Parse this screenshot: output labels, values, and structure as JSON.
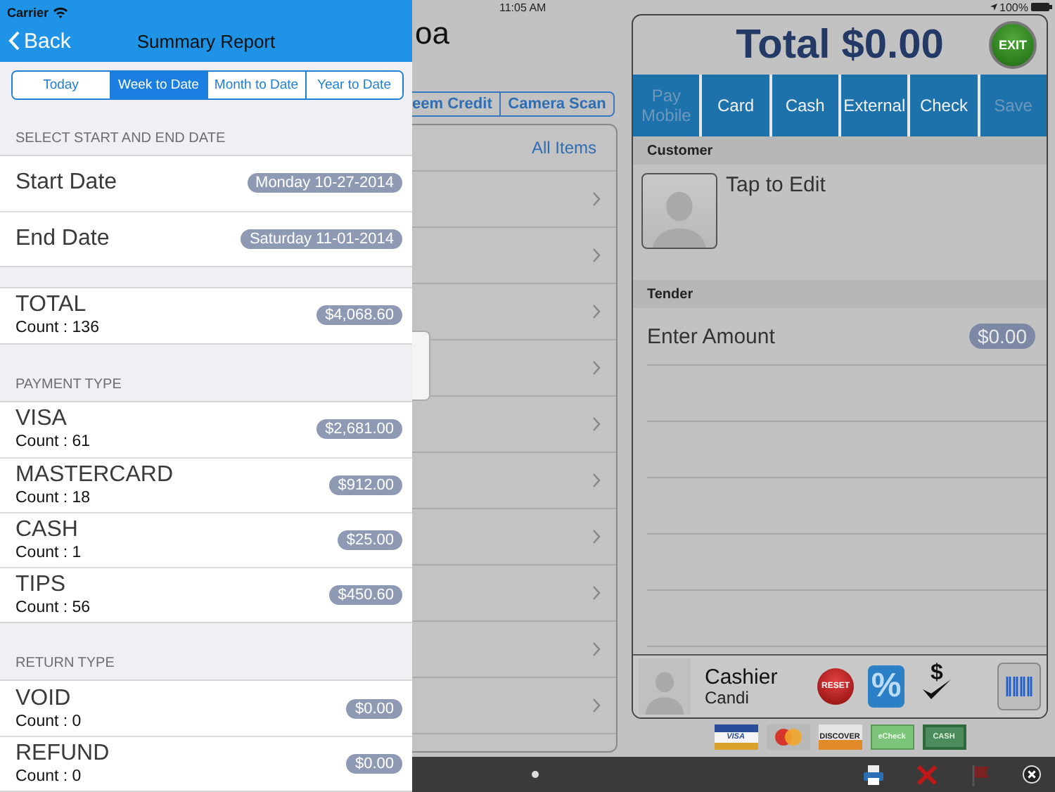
{
  "status_bar": {
    "carrier": "Carrier",
    "time": "11:05 AM",
    "battery": "100%"
  },
  "report": {
    "back": "Back",
    "title": "Summary Report",
    "periods": [
      {
        "label": "Today",
        "selected": false
      },
      {
        "label": "Week to Date",
        "selected": true
      },
      {
        "label": "Month to Date",
        "selected": false
      },
      {
        "label": "Year to Date",
        "selected": false
      }
    ],
    "sections": [
      {
        "header": "SELECT START AND END DATE",
        "rows": [
          {
            "title": "Start Date",
            "value": "Monday 10-27-2014"
          },
          {
            "title": "End Date",
            "value": "Saturday 11-01-2014"
          }
        ]
      },
      {
        "rows": [
          {
            "title": "TOTAL",
            "count": "Count : 136",
            "value": "$4,068.60"
          }
        ]
      },
      {
        "header": "PAYMENT TYPE",
        "rows": [
          {
            "title": "VISA",
            "count": "Count : 61",
            "value": "$2,681.00"
          },
          {
            "title": "MASTERCARD",
            "count": "Count : 18",
            "value": "$912.00"
          },
          {
            "title": "CASH",
            "count": "Count : 1",
            "value": "$25.00"
          },
          {
            "title": "TIPS",
            "count": "Count : 56",
            "value": "$450.60"
          }
        ]
      },
      {
        "header": "RETURN TYPE",
        "rows": [
          {
            "title": "VOID",
            "count": "Count : 0",
            "value": "$0.00"
          },
          {
            "title": "REFUND",
            "count": "Count : 0",
            "value": "$0.00"
          }
        ]
      }
    ]
  },
  "register": {
    "title": "oa",
    "actions": [
      {
        "label": "eem Credit"
      },
      {
        "label": "Camera Scan"
      }
    ],
    "list_header": "All Items"
  },
  "checkout": {
    "total": "Total $0.00",
    "exit": "EXIT",
    "tenders": [
      {
        "label": "Pay Mobile",
        "disabled": true
      },
      {
        "label": "Card",
        "disabled": false
      },
      {
        "label": "Cash",
        "disabled": false
      },
      {
        "label": "External",
        "disabled": false
      },
      {
        "label": "Check",
        "disabled": false
      },
      {
        "label": "Save",
        "disabled": true
      }
    ],
    "customer_header": "Customer",
    "customer_action": "Tap to Edit",
    "tender_header": "Tender",
    "amount_label": "Enter Amount",
    "amount": "$0.00",
    "cashier_label": "Cashier",
    "cashier_name": "Candi",
    "reset": "RESET",
    "discount": "%",
    "payout_symbol": "$"
  },
  "payment_logos": [
    {
      "kind": "visa",
      "label": "VISA"
    },
    {
      "kind": "mastercard"
    },
    {
      "kind": "discover",
      "label": "DISCOVER"
    },
    {
      "kind": "echeck",
      "label": "eCheck"
    },
    {
      "kind": "cash",
      "label": "CASH"
    }
  ]
}
